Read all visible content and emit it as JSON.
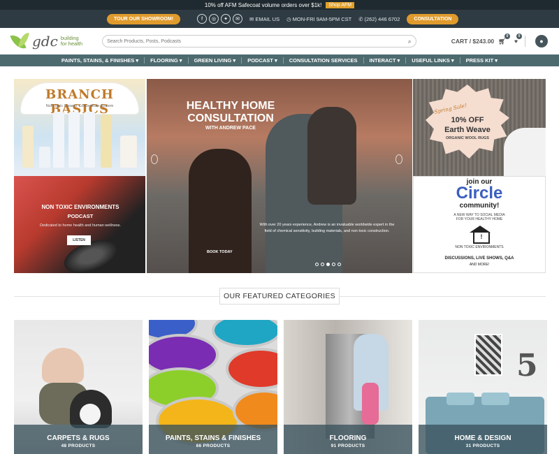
{
  "announcement": {
    "text": "10% off AFM Safecoat volume orders over $1k!",
    "shop_label": "Shop AFM"
  },
  "topbar": {
    "showroom_label": "TOUR OUR SHOWROOM!",
    "email_label": "EMAIL US",
    "hours_label": "MON-FRI 9AM-5PM CST",
    "phone_label": "(262) 446 6702",
    "consultation_label": "CONSULTATION",
    "social_icons": [
      "facebook-icon",
      "instagram-icon",
      "twitter-icon",
      "email-icon"
    ]
  },
  "header": {
    "logo_text": "gdc",
    "logo_tagline": "building for health",
    "search_placeholder": "Search Products, Posts, Podcasts",
    "cart_label": "CART / $243.00",
    "cart_count": "0",
    "wishlist_count": "0"
  },
  "nav": {
    "items": [
      {
        "label": "PAINTS, STAINS, & FINISHES"
      },
      {
        "label": "FLOORING"
      },
      {
        "label": "GREEN LIVING"
      },
      {
        "label": "PODCAST"
      },
      {
        "label": "CONSULTATION SERVICES"
      },
      {
        "label": "INTERACT"
      },
      {
        "label": "USEFUL LINKS"
      },
      {
        "label": "PRESS KIT"
      }
    ]
  },
  "hero": {
    "branch": {
      "title": "BRANCH BASICS",
      "subtitle": "Non-Toxic Cleaner Concentrate System"
    },
    "podcast": {
      "title": "NON TOXIC ENVIRONMENTS",
      "title2": "PODCAST",
      "description": "Dedicated to home health and human wellness.",
      "button": "LISTEN"
    },
    "main": {
      "title_line1": "HEALTHY HOME",
      "title_line2": "CONSULTATION",
      "subtitle": "WITH ANDREW PACE",
      "description": "With over 20 years experience, Andrew is an invaluable worldwide expert in the field of chemical sensitivity, building materials, and non toxic construction.",
      "book_label": "BOOK TODAY",
      "active_slide": 3,
      "slides": 5
    },
    "earthweave": {
      "sale": "Spring Sale!",
      "line1": "10% OFF",
      "line2": "Earth Weave",
      "line3": "ORGANIC WOOL RUGS"
    },
    "circle": {
      "join": "join our",
      "circle": "Circle",
      "community": "community!",
      "tagline1": "A NEW WAY TO SOCIAL MEDIA",
      "tagline2": "FOR YOUR HEALTHY HOME",
      "caption": "NON TOXIC ENVIRONMENTS",
      "discussions": "DISCUSSIONS, LIVE SHOWS, Q&A",
      "more": "AND MORE!"
    }
  },
  "featured": {
    "heading": "OUR FEATURED CATEGORIES",
    "categories": [
      {
        "name": "CARPETS & RUGS",
        "count": "48 PRODUCTS"
      },
      {
        "name": "PAINTS, STAINS & FINISHES",
        "count": "66 PRODUCTS"
      },
      {
        "name": "FLOORING",
        "count": "91 PRODUCTS"
      },
      {
        "name": "HOME & DESIGN",
        "count": "31 PRODUCTS"
      }
    ]
  },
  "colors": {
    "accent": "#e09b2d",
    "nav": "#4d6a6f",
    "topbar": "#2f3b42",
    "circle_blue": "#3b5fc0"
  }
}
